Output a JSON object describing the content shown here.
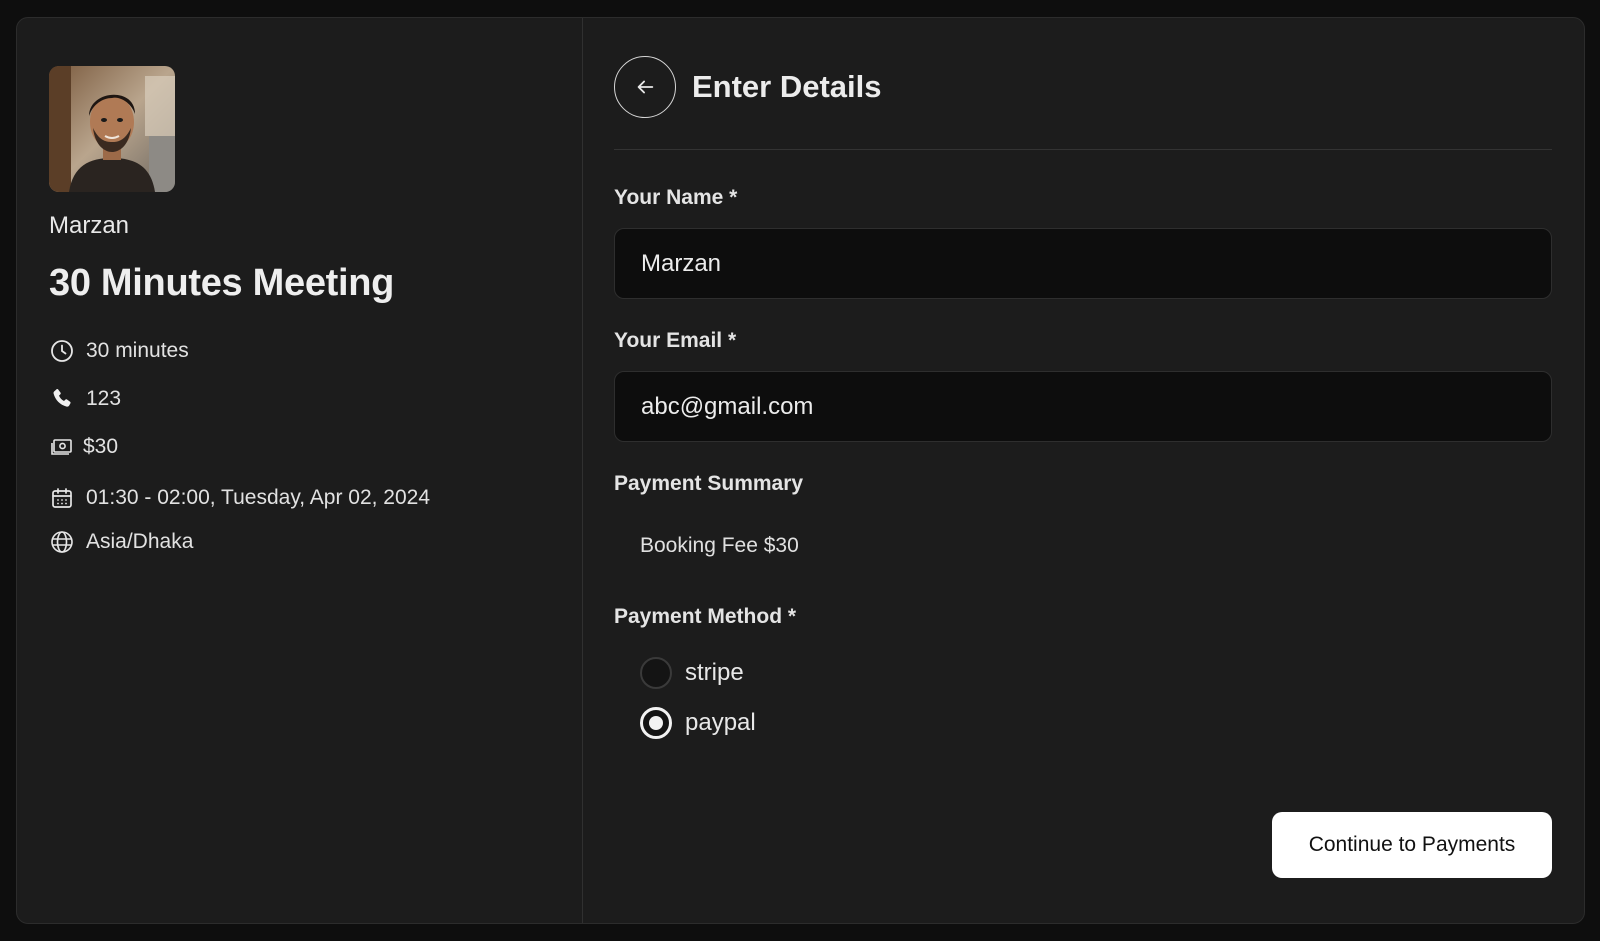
{
  "host": {
    "name": "Marzan",
    "avatar_icon": "user-avatar-photo"
  },
  "meeting": {
    "title": "30 Minutes Meeting",
    "details": {
      "duration": "30 minutes",
      "phone": "123",
      "price": "$30",
      "datetime": "01:30 - 02:00, Tuesday, Apr 02, 2024",
      "timezone": "Asia/Dhaka"
    }
  },
  "form": {
    "title": "Enter Details",
    "name_label": "Your Name *",
    "name_value": "Marzan",
    "email_label": "Your Email *",
    "email_value": "abc@gmail.com",
    "summary_label": "Payment Summary",
    "summary_line": "Booking Fee $30",
    "method_label": "Payment Method *",
    "methods": [
      {
        "label": "stripe",
        "selected": false
      },
      {
        "label": "paypal",
        "selected": true
      }
    ],
    "continue_label": "Continue to Payments"
  },
  "colors": {
    "page_bg": "#0e0e0e",
    "card_bg": "#1c1c1c",
    "input_bg": "#0d0d0d",
    "primary_button_bg": "#ffffff",
    "primary_button_text": "#111111"
  }
}
